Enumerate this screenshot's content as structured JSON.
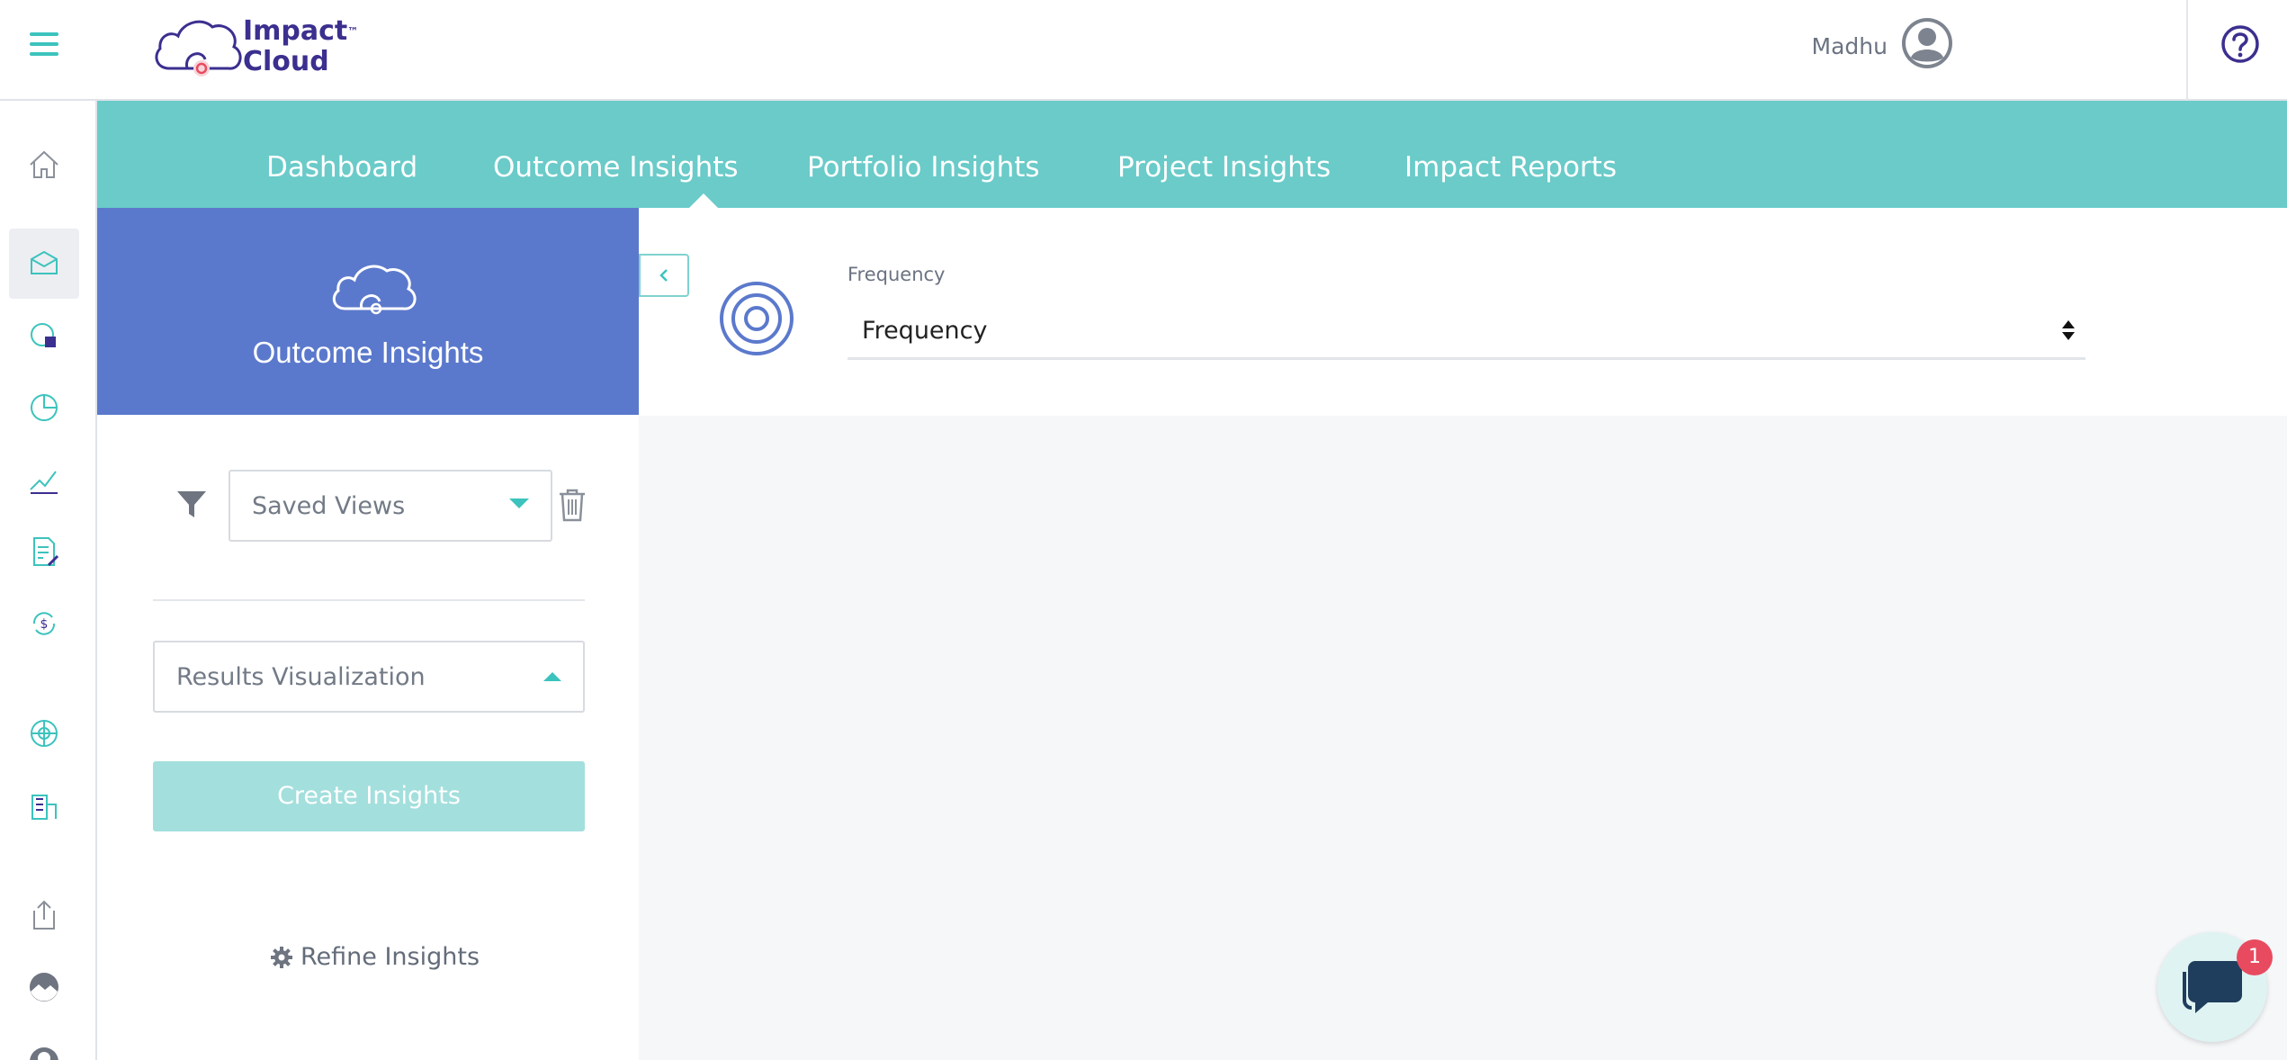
{
  "header": {
    "logo_text_line1": "Impact",
    "logo_tm": "™",
    "logo_text_line2": "Cloud",
    "user_name": "Madhu",
    "help_icon": "question-circle-icon"
  },
  "rail": {
    "items": [
      {
        "icon": "home-icon"
      },
      {
        "icon": "inbox-icon",
        "active": true
      },
      {
        "icon": "chart-doc-icon"
      },
      {
        "icon": "pie-chart-icon"
      },
      {
        "icon": "trend-line-icon"
      },
      {
        "icon": "document-edit-icon"
      },
      {
        "icon": "dollar-cycle-icon"
      },
      {
        "icon": "globe-icon"
      },
      {
        "icon": "building-icon"
      },
      {
        "icon": "export-icon"
      },
      {
        "icon": "landscape-icon"
      },
      {
        "icon": "user-circle-icon"
      }
    ]
  },
  "nav": {
    "tabs": [
      {
        "label": "Dashboard"
      },
      {
        "label": "Outcome Insights",
        "active": true
      },
      {
        "label": "Portfolio Insights"
      },
      {
        "label": "Project Insights"
      },
      {
        "label": "Impact Reports"
      }
    ]
  },
  "panel": {
    "title": "Outcome Insights",
    "saved_views_label": "Saved Views",
    "results_visualization_label": "Results Visualization",
    "create_button": "Create Insights",
    "refine_label": "Refine Insights"
  },
  "main": {
    "frequency_label": "Frequency",
    "frequency_value": "Frequency"
  },
  "chat": {
    "badge_count": "1"
  },
  "colors": {
    "accent": "#3cc3bd",
    "tabbar": "#6acbc9",
    "panel_header": "#5b79cc",
    "create_button_bg": "#a3dfdd",
    "badge": "#e84b5f"
  }
}
